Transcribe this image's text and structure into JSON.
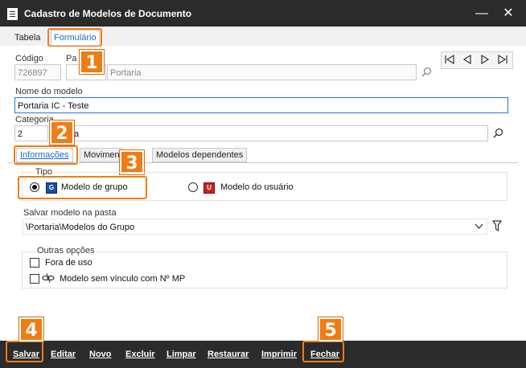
{
  "window": {
    "title": "Cadastro de Modelos de Documento"
  },
  "tabs": {
    "tabela": "Tabela",
    "formulario": "Formulário"
  },
  "form": {
    "codigo_label": "Código",
    "codigo_value": "726897",
    "pasta_label": "Pa",
    "pasta_value": "Portaria",
    "nome_label": "Nome do modelo",
    "nome_value": "Portaria IC - Teste",
    "categoria_label": "Categoria",
    "categoria_code": "2",
    "categoria_value": "a"
  },
  "subtabs": {
    "informacoes": "Informações",
    "movimentos": "Movimen",
    "dependentes": "Modelos dependentes"
  },
  "tipo": {
    "label": "Tipo",
    "grupo_label": "Modelo de grupo",
    "grupo_badge": "G",
    "usuario_label": "Modelo do usuário",
    "usuario_badge": "U",
    "selected": "grupo"
  },
  "salvar_pasta": {
    "label": "Salvar modelo na pasta",
    "value": "\\Portaria\\Modelos do Grupo"
  },
  "outras": {
    "label": "Outras opções",
    "fora_de_uso": "Fora de uso",
    "sem_vinculo": "Modelo sem vínculo com Nº MP"
  },
  "callouts": {
    "c1": "1",
    "c2": "2",
    "c3": "3",
    "c4": "4",
    "c5": "5"
  },
  "toolbar": {
    "salvar": "Salvar",
    "editar": "Editar",
    "novo": "Novo",
    "excluir": "Excluir",
    "limpar": "Limpar",
    "restaurar": "Restaurar",
    "imprimir": "Imprimir",
    "fechar": "Fechar"
  },
  "colors": {
    "accent": "#f07c14",
    "titlebar": "#2b2b2b",
    "link": "#1a6cc4",
    "focus": "#1f7ad6",
    "badge_group": "#1a4fa0",
    "badge_user": "#d01f1f"
  }
}
